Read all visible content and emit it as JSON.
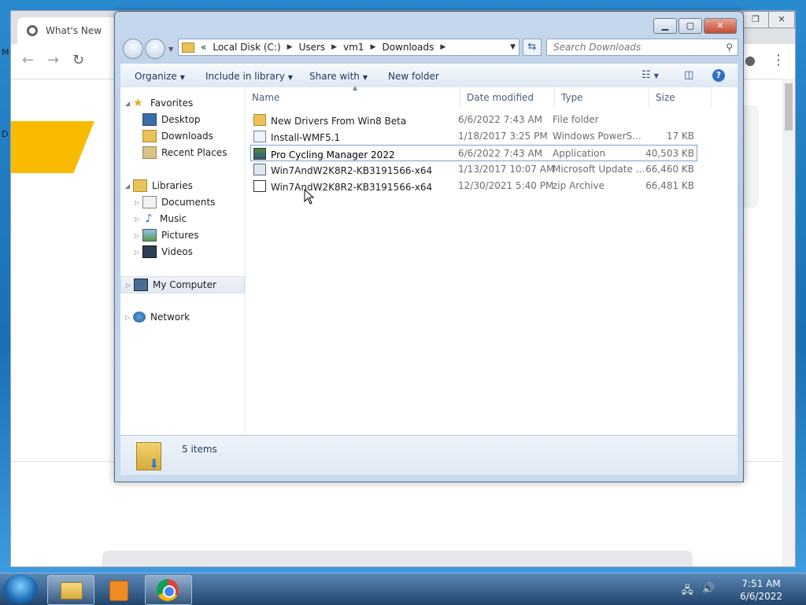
{
  "chrome": {
    "tab_title": "What's New",
    "left_edge_letters": [
      "M",
      "D"
    ]
  },
  "explorer": {
    "breadcrumb": [
      "Local Disk (C:)",
      "Users",
      "vm1",
      "Downloads"
    ],
    "breadcrumb_prefix": "«",
    "search_placeholder": "Search Downloads",
    "toolbar": {
      "organize": "Organize",
      "include_in_library": "Include in library",
      "share_with": "Share with",
      "new_folder": "New folder"
    },
    "nav": {
      "favorites": "Favorites",
      "desktop": "Desktop",
      "downloads": "Downloads",
      "recent_places": "Recent Places",
      "libraries": "Libraries",
      "documents": "Documents",
      "music": "Music",
      "pictures": "Pictures",
      "videos": "Videos",
      "my_computer": "My Computer",
      "network": "Network"
    },
    "columns": {
      "name": "Name",
      "date_modified": "Date modified",
      "type": "Type",
      "size": "Size"
    },
    "files": [
      {
        "name": "New Drivers From Win8 Beta",
        "date": "6/6/2022 7:43 AM",
        "type": "File folder",
        "size": "",
        "icon": "folder-icon"
      },
      {
        "name": "Install-WMF5.1",
        "date": "1/18/2017 3:25 PM",
        "type": "Windows PowerS...",
        "size": "17 KB",
        "icon": "powershell-script-icon"
      },
      {
        "name": "Pro Cycling Manager 2022",
        "date": "6/6/2022 7:43 AM",
        "type": "Application",
        "size": "40,503 KB",
        "icon": "application-icon"
      },
      {
        "name": "Win7AndW2K8R2-KB3191566-x64",
        "date": "1/13/2017 10:07 AM",
        "type": "Microsoft Update ...",
        "size": "66,460 KB",
        "icon": "update-package-icon"
      },
      {
        "name": "Win7AndW2K8R2-KB3191566-x64",
        "date": "12/30/2021 5:40 PM",
        "type": "zip Archive",
        "size": "66,481 KB",
        "icon": "zip-archive-icon"
      }
    ],
    "item_count": "5 items"
  },
  "taskbar": {
    "time": "7:51 AM",
    "date": "6/6/2022"
  }
}
